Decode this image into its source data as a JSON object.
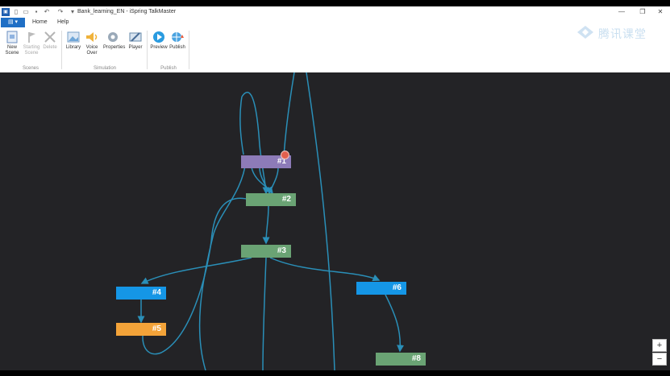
{
  "window": {
    "title": "Bank_learning_EN - iSpring TalkMaster",
    "minimize_glyph": "—",
    "maximize_glyph": "❐",
    "close_glyph": "✕"
  },
  "quick_access": {
    "save_icon": "save-icon",
    "new_icon": "new-file-icon",
    "open_icon": "open-folder-icon",
    "undo_icon": "undo-icon",
    "redo_icon": "redo-icon",
    "undo_glyph": "↶",
    "redo_glyph": "↷",
    "dropdown_glyph": "▾"
  },
  "ribbon": {
    "file_button": "▤ ▾",
    "tabs": [
      "Home",
      "Help"
    ],
    "buttons": {
      "new_scene": "New Scene",
      "starting_scene": "Starting Scene",
      "delete": "Delete",
      "library": "Library",
      "voice_over": "Voice Over",
      "properties": "Properties",
      "player": "Player",
      "preview": "Preview",
      "publish": "Publish"
    },
    "groups": [
      "Scenes",
      "Simulation",
      "Publish"
    ]
  },
  "watermark": "腾讯课堂",
  "colors": {
    "canvas_bg": "#232326",
    "link": "#2a8fb8",
    "accent": "#1f6fc5"
  },
  "nodes": [
    {
      "id": "n1",
      "label": "#1",
      "color": "purple"
    },
    {
      "id": "n2",
      "label": "#2",
      "color": "green"
    },
    {
      "id": "n3",
      "label": "#3",
      "color": "green"
    },
    {
      "id": "n4",
      "label": "#4",
      "color": "blue"
    },
    {
      "id": "n5",
      "label": "#5",
      "color": "orange"
    },
    {
      "id": "n6",
      "label": "#6",
      "color": "blue"
    },
    {
      "id": "n8",
      "label": "#8",
      "color": "green"
    }
  ],
  "zoom": {
    "in": "+",
    "out": "−"
  }
}
